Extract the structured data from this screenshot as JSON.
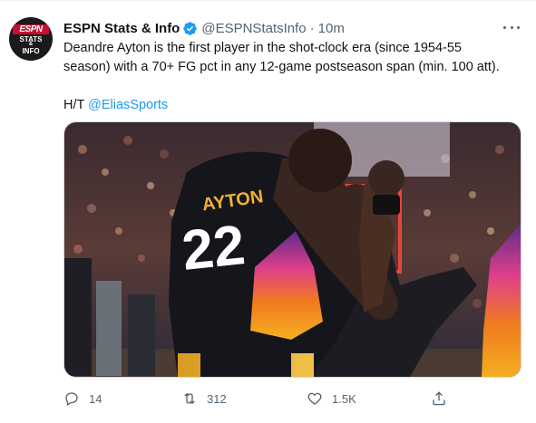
{
  "tweet": {
    "display_name": "ESPN Stats & Info",
    "handle": "@ESPNStatsInfo",
    "separator": "·",
    "time": "10m",
    "avatar": {
      "brand": "ESPN",
      "line1": "STATS",
      "line2": "&",
      "line3": "INFO"
    },
    "text_line1": "Deandre Ayton is the first player in the shot-clock era (since 1954-55",
    "text_line2": "season) with a 70+ FG pct in any 12-game postseason span (min. 100 att).",
    "ht_prefix": "H/T ",
    "ht_mention": "@EliasSports",
    "media": {
      "jersey_name": "AYTON",
      "jersey_number": "22"
    }
  },
  "actions": {
    "replies": "14",
    "retweets": "312",
    "likes": "1.5K"
  },
  "colors": {
    "link": "#1d9bf0",
    "secondary_text": "#536471",
    "verified": "#1d9bf0",
    "suns_purple": "#1d1160",
    "suns_orange": "#e56020"
  },
  "icons": [
    "verified-badge-icon",
    "more-options-icon",
    "reply-icon",
    "retweet-icon",
    "like-icon",
    "share-icon"
  ]
}
